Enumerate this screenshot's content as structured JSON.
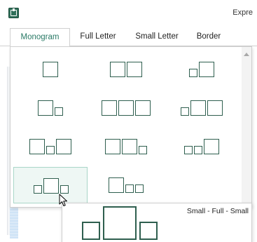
{
  "window": {
    "title": "Expre"
  },
  "tabs": [
    {
      "label": "Monogram",
      "active": true
    },
    {
      "label": "Full Letter",
      "active": false
    },
    {
      "label": "Small Letter",
      "active": false
    },
    {
      "label": "Border",
      "active": false
    }
  ],
  "colors": {
    "accent": "#2a7a66",
    "square_border": "#2f5f4f",
    "hover_bg": "#eef7f4",
    "hover_border": "#a9d6c8"
  },
  "layouts": [
    {
      "name": "Full",
      "pattern": [
        "F"
      ]
    },
    {
      "name": "Full - Full",
      "pattern": [
        "F",
        "F"
      ]
    },
    {
      "name": "Small - Full",
      "pattern": [
        "S",
        "F"
      ]
    },
    {
      "name": "Full - Small",
      "pattern": [
        "F",
        "S"
      ]
    },
    {
      "name": "Full - Full - Full",
      "pattern": [
        "F",
        "F",
        "F"
      ]
    },
    {
      "name": "Small - Full - Full",
      "pattern": [
        "S",
        "F",
        "F"
      ]
    },
    {
      "name": "Full - Small - Full",
      "pattern": [
        "F",
        "S",
        "F"
      ]
    },
    {
      "name": "Full - Full - Small",
      "pattern": [
        "F",
        "F",
        "S"
      ]
    },
    {
      "name": "Small - Small - Full",
      "pattern": [
        "S",
        "S",
        "F"
      ]
    },
    {
      "name": "Small - Full - Small",
      "pattern": [
        "S",
        "F",
        "S"
      ],
      "hovered": true
    },
    {
      "name": "Full - Small - Small",
      "pattern": [
        "F",
        "S",
        "S"
      ]
    }
  ],
  "tooltip": {
    "label": "Small - Full - Small",
    "pattern": [
      "S",
      "F",
      "S"
    ]
  },
  "icons": {
    "app": "app-icon",
    "cursor": "mouse-pointer-icon",
    "scroll_up": "scroll-up-arrow-icon"
  }
}
